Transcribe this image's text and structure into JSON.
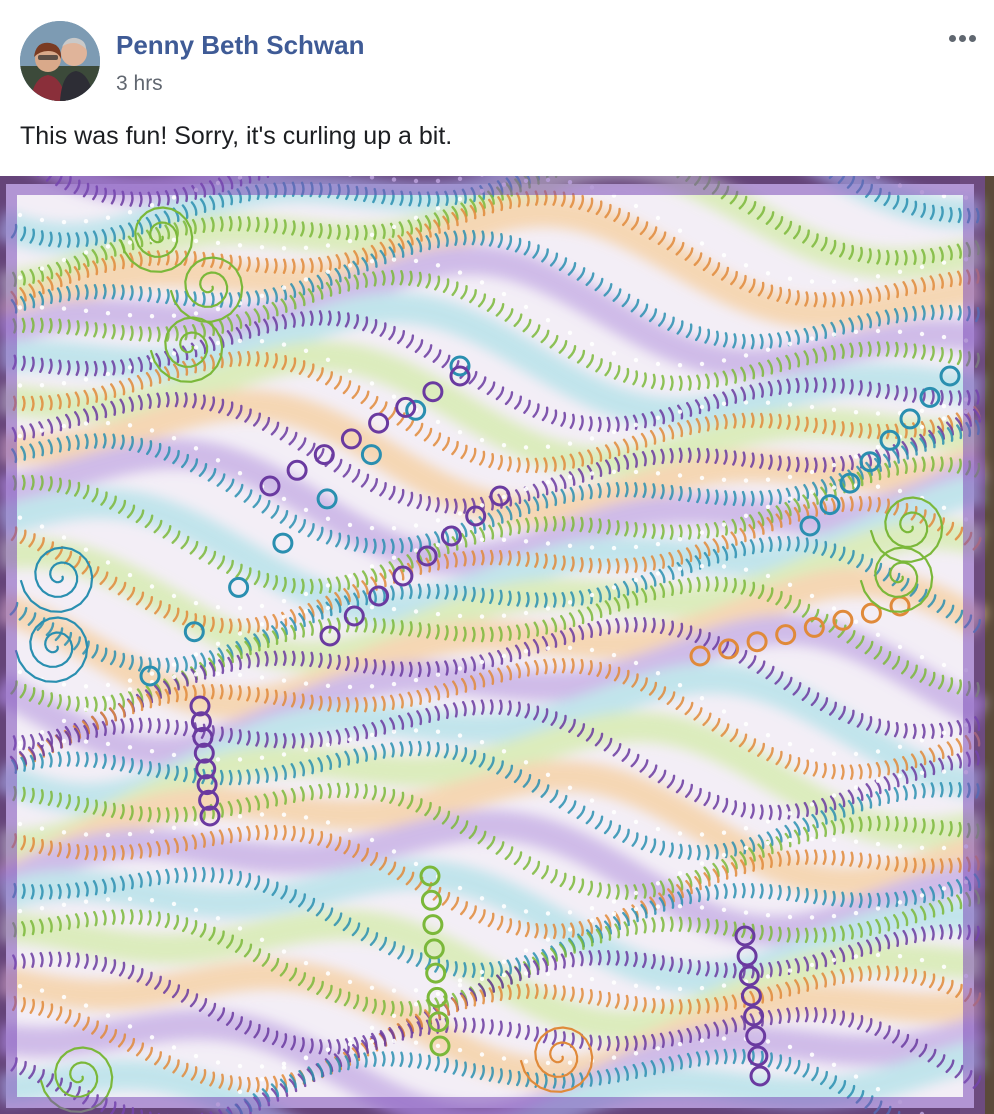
{
  "post": {
    "author": {
      "name": "Penny Beth Schwan",
      "avatar_icon": "profile-photo-couple"
    },
    "timestamp": "3 hrs",
    "more_icon": "more-options-ellipsis-icon",
    "text": "This was fun! Sorry, it's curling up a bit.",
    "photo": {
      "subject": "zentangle-style watercolor artwork tile",
      "colors": {
        "purple": "#6a3aa0",
        "teal": "#2a8fb0",
        "green": "#7bb83a",
        "orange": "#e08a3a",
        "lavender": "#d9c4ea",
        "background_wood": "#4a3a2e"
      }
    }
  },
  "colors": {
    "author_link": "#3f5b96",
    "secondary_text": "#616770",
    "body_text": "#1c1e21",
    "icon_gray": "#606770"
  }
}
